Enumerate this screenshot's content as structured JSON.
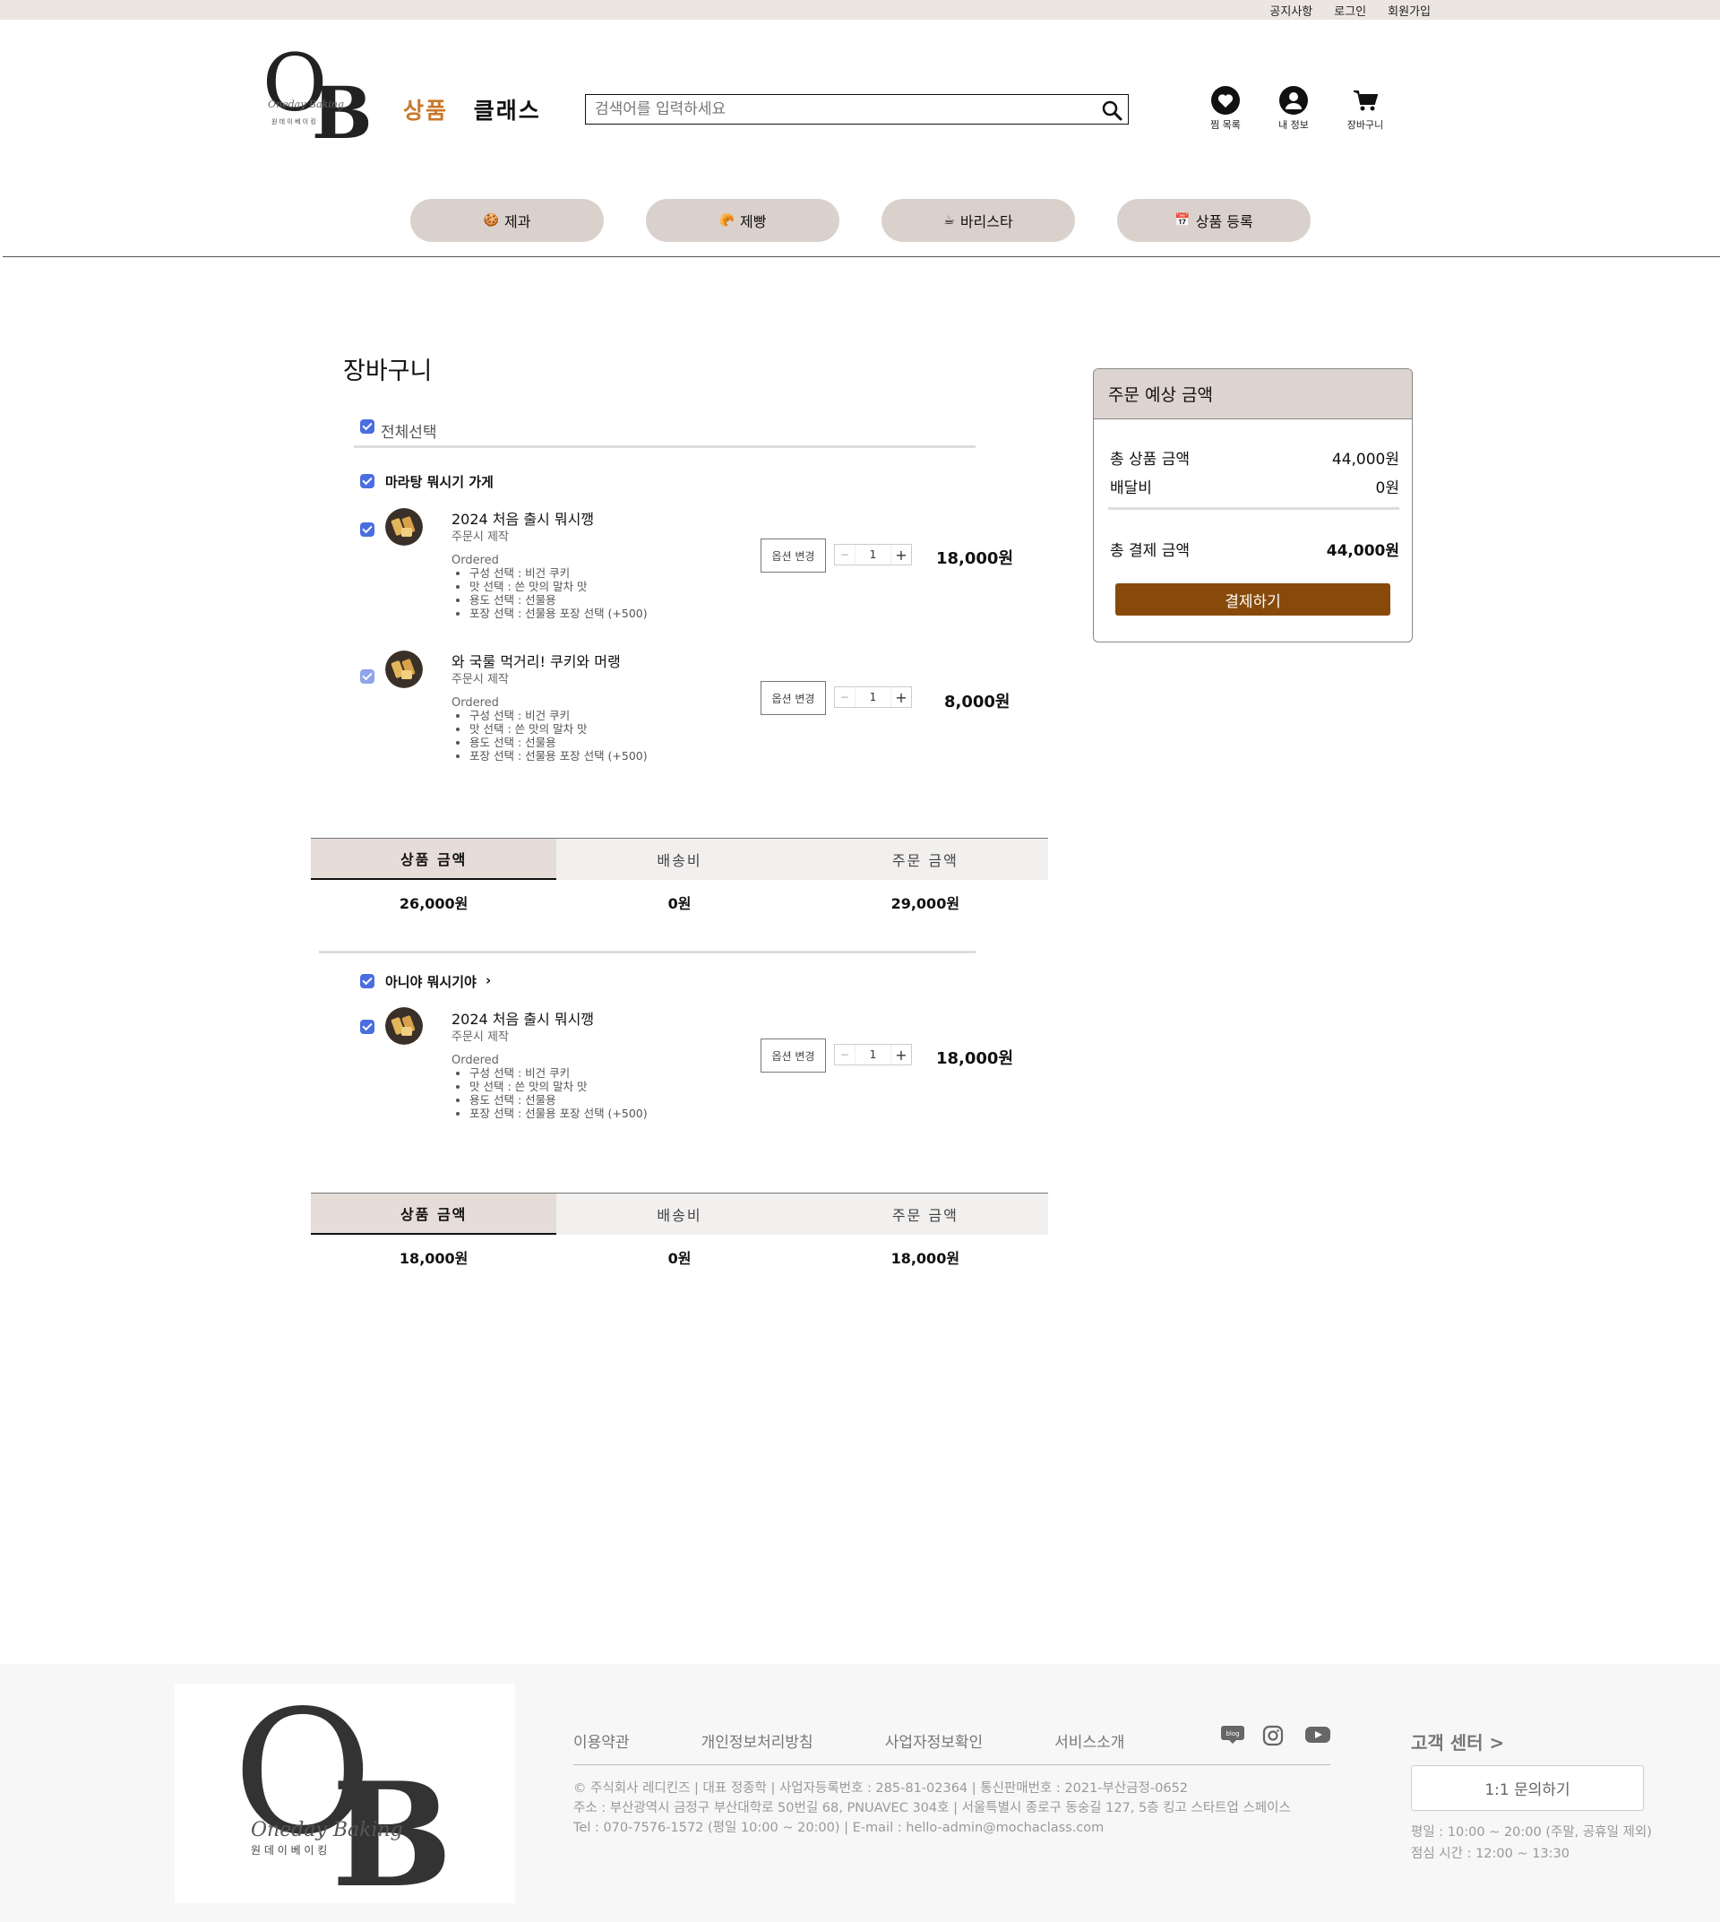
{
  "topbar": {
    "notice": "공지사항",
    "login": "로그인",
    "signup": "회원가입"
  },
  "header": {
    "nav_product": "상품",
    "nav_class": "클래스",
    "search_placeholder": "검색어를 입력하세요",
    "wishlist": "찜 목록",
    "myinfo": "내 정보",
    "cart": "장바구니"
  },
  "categories": [
    {
      "emoji": "🍪",
      "label": "제과"
    },
    {
      "emoji": "🥐",
      "label": "제빵"
    },
    {
      "emoji": "☕",
      "label": "바리스타"
    },
    {
      "emoji": "📅",
      "label": "상품 등록"
    }
  ],
  "cart": {
    "title": "장바구니",
    "select_all": "전체선택",
    "option_change": "옵션 변경",
    "ordered_label": "Ordered",
    "stores": [
      {
        "name": "마라탕 뭐시기 가게",
        "items": [
          {
            "name": "2024 처음 출시 뭐시깽",
            "sub": "주문시 제작",
            "options": [
              "구성 선택 : 비건 쿠키",
              "맛 선택 : 쓴 맛의 말차 맛",
              "용도 선택 : 선물용",
              "포장 선택 : 선물용 포장 선택 (+500)"
            ],
            "qty": "1",
            "price": "18,000원"
          },
          {
            "name": "와 국룰 먹거리! 쿠키와 머랭",
            "sub": "주문시 제작",
            "options": [
              "구성 선택 : 비건 쿠키",
              "맛 선택 : 쓴 맛의 말차 맛",
              "용도 선택 : 선물용",
              "포장 선택 : 선물용 포장 선택 (+500)"
            ],
            "qty": "1",
            "price": "8,000원"
          }
        ],
        "summary": {
          "product_label": "상품 금액",
          "shipping_label": "배송비",
          "order_label": "주문 금액",
          "product": "26,000원",
          "shipping": "0원",
          "order": "29,000원"
        }
      },
      {
        "name": "아니야 뭐시기야",
        "items": [
          {
            "name": "2024 처음 출시 뭐시깽",
            "sub": "주문시 제작",
            "options": [
              "구성 선택 : 비건 쿠키",
              "맛 선택 : 쓴 맛의 말차 맛",
              "용도 선택 : 선물용",
              "포장 선택 : 선물용 포장 선택 (+500)"
            ],
            "qty": "1",
            "price": "18,000원"
          }
        ],
        "summary": {
          "product_label": "상품 금액",
          "shipping_label": "배송비",
          "order_label": "주문 금액",
          "product": "18,000원",
          "shipping": "0원",
          "order": "18,000원"
        }
      }
    ]
  },
  "order_summary": {
    "title": "주문 예상 금액",
    "total_product_label": "총 상품 금액",
    "total_product": "44,000원",
    "delivery_label": "배달비",
    "delivery": "0원",
    "total_pay_label": "총 결제 금액",
    "total_pay": "44,000원",
    "pay_button": "결제하기"
  },
  "footer": {
    "links": [
      "이용약관",
      "개인정보처리방침",
      "사업자정보확인",
      "서비스소개"
    ],
    "blog_label": "blog",
    "info_line1": "© 주식회사 레디킨즈 | 대표 정종학 | 사업자등록번호 : 285-81-02364 | 통신판매번호 : 2021-부산금정-0652",
    "info_line2": "주소 : 부산광역시 금정구 부산대학로 50번길 68, PNUAVEC 304호 | 서울특별시 종로구 동숭길 127, 5층 킹고 스타트업 스페이스",
    "info_line3": "Tel : 070-7576-1572 (평일 10:00 ~ 20:00) | E-mail : hello-admin@mochaclass.com",
    "cs_title": "고객 센터 >",
    "cs_button": "1:1 문의하기",
    "cs_hours": "평일 : 10:00 ~ 20:00 (주말, 공휴일 제외)",
    "cs_lunch": "점심 시간 : 12:00 ~ 13:30"
  },
  "colors": {
    "accent": "#c9782c",
    "pay": "#874a0b",
    "pill": "#dbd1cc",
    "check": "#4a6ee0"
  }
}
